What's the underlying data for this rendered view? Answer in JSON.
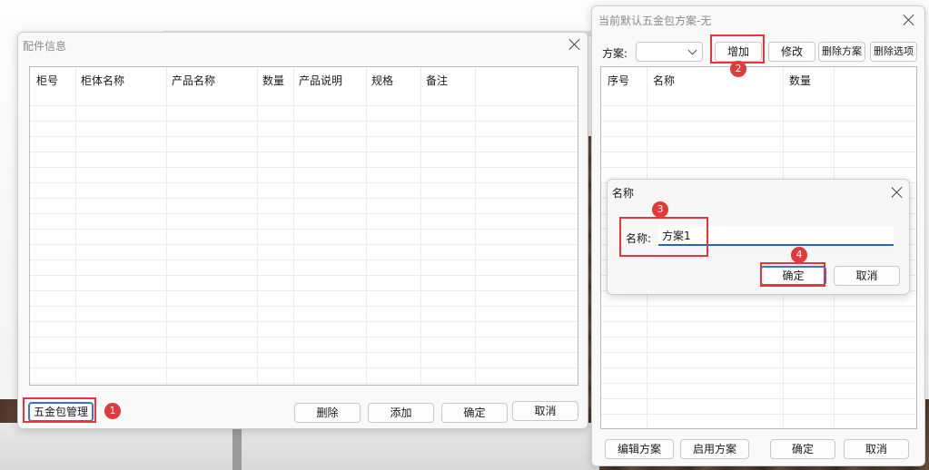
{
  "left_window": {
    "title": "配件信息",
    "columns": [
      "柜号",
      "柜体名称",
      "产品名称",
      "数量",
      "产品说明",
      "规格",
      "备注"
    ],
    "buttons": {
      "hardware_mgmt": "五金包管理",
      "delete": "删除",
      "add": "添加",
      "ok": "确定",
      "cancel": "取消"
    },
    "badge": "1"
  },
  "right_window": {
    "title": "当前默认五金包方案-无",
    "scheme_label": "方案:",
    "scheme_value": "",
    "buttons": {
      "add": "增加",
      "modify": "修改",
      "delete_scheme": "删除方案",
      "delete_option": "删除选项",
      "edit_scheme": "编辑方案",
      "enable_scheme": "启用方案",
      "ok": "确定",
      "cancel": "取消"
    },
    "columns": [
      "序号",
      "名称",
      "数量"
    ],
    "badge": "2"
  },
  "name_dialog": {
    "title": "名称",
    "label": "名称:",
    "input_value": "方案1",
    "buttons": {
      "ok": "确定",
      "cancel": "取消"
    },
    "badges": [
      "3",
      "4"
    ]
  },
  "colors": {
    "highlight": "#e8343b",
    "badge": "#e23a3a",
    "focus": "#2f62c9"
  }
}
